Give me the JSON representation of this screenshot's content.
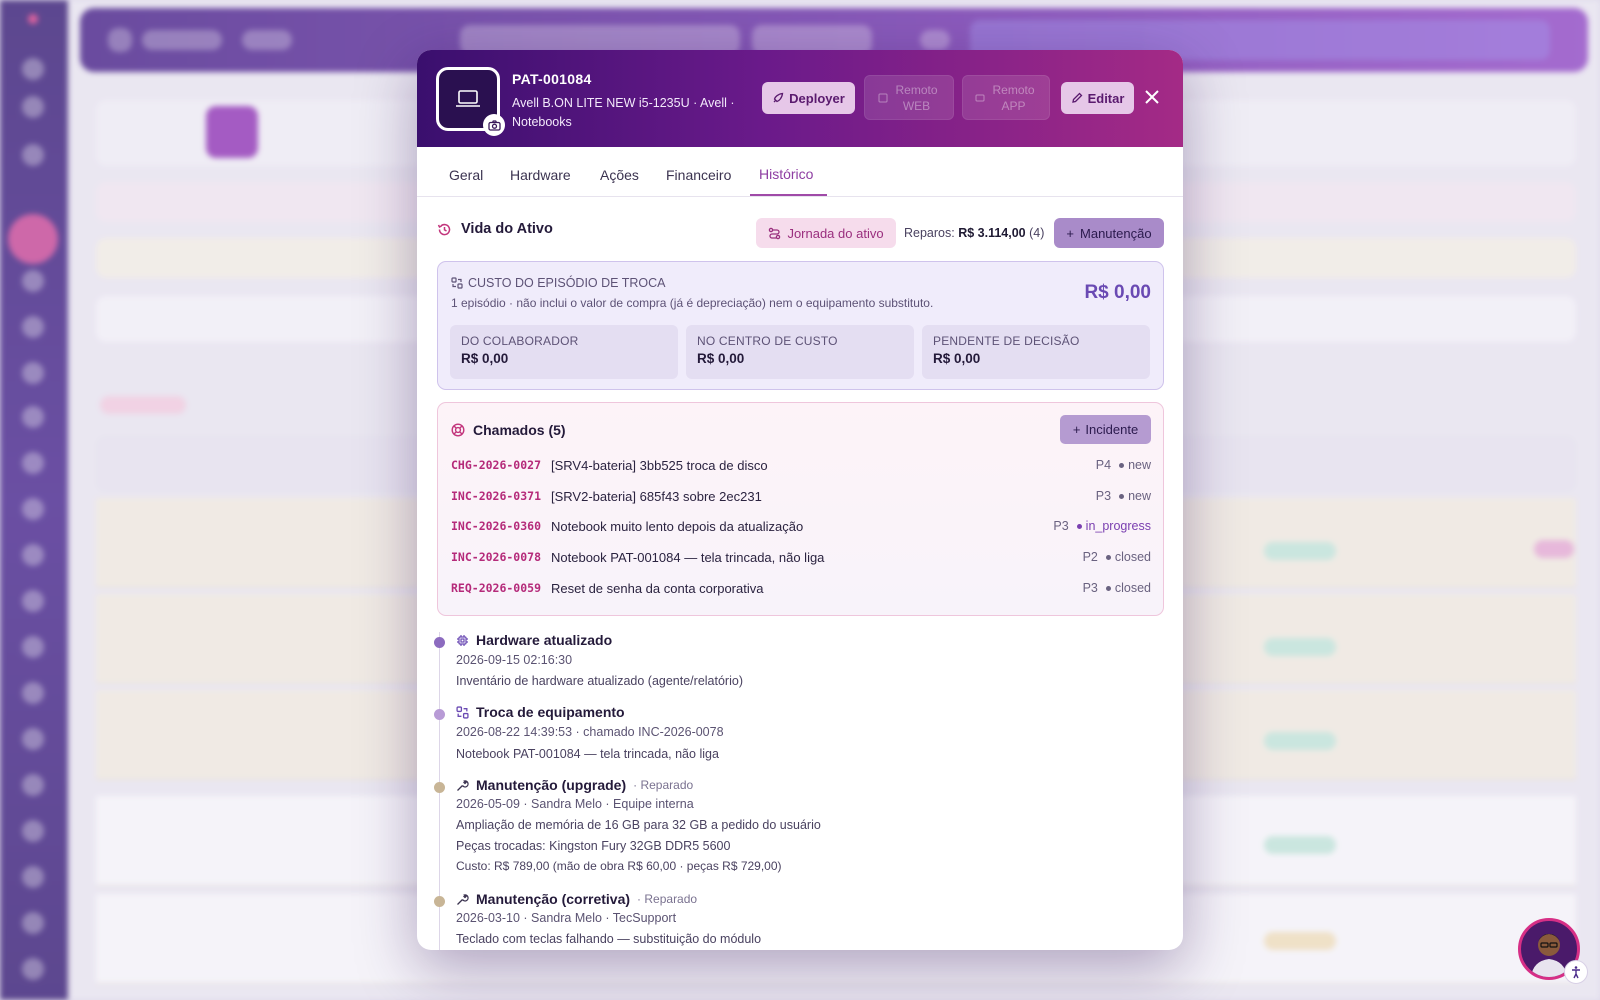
{
  "modal": {
    "asset_id": "PAT-001084",
    "asset_description": "Avell B.ON LITE NEW i5-1235U · Avell · Notebooks",
    "buttons": {
      "deploy": "Deployer",
      "remote_web": "Remoto WEB",
      "remote_app": "Remoto APP",
      "edit": "Editar"
    },
    "tabs": [
      "Geral",
      "Hardware",
      "Ações",
      "Financeiro",
      "Histórico"
    ],
    "active_tab": "Histórico",
    "history": {
      "title": "Vida do Ativo",
      "journey_button": "Jornada do ativo",
      "repairs_label": "Reparos:",
      "repairs_value": "R$ 3.114,00",
      "repairs_count": "(4)",
      "maintenance_button": "Manutenção"
    },
    "swap_cost": {
      "title": "CUSTO DO EPISÓDIO DE TROCA",
      "description": "1 episódio · não inclui o valor de compra (já é depreciação) nem o equipamento substituto.",
      "total": "R$ 0,00",
      "boxes": [
        {
          "label": "DO COLABORADOR",
          "value": "R$ 0,00"
        },
        {
          "label": "NO CENTRO DE CUSTO",
          "value": "R$ 0,00"
        },
        {
          "label": "PENDENTE DE DECISÃO",
          "value": "R$ 0,00"
        }
      ]
    },
    "tickets": {
      "title": "Chamados (5)",
      "incident_button": "Incidente",
      "items": [
        {
          "code": "CHG-2026-0027",
          "title": "[SRV4-bateria] 3bb525 troca de disco",
          "priority": "P4",
          "status": "new"
        },
        {
          "code": "INC-2026-0371",
          "title": "[SRV2-bateria] 685f43 sobre 2ec231",
          "priority": "P3",
          "status": "new"
        },
        {
          "code": "INC-2026-0360",
          "title": "Notebook muito lento depois da atualização",
          "priority": "P3",
          "status": "in_progress"
        },
        {
          "code": "INC-2026-0078",
          "title": "Notebook PAT-001084 — tela trincada, não liga",
          "priority": "P2",
          "status": "closed"
        },
        {
          "code": "REQ-2026-0059",
          "title": "Reset de senha da conta corporativa",
          "priority": "P3",
          "status": "closed"
        }
      ]
    },
    "timeline": [
      {
        "title": "Hardware atualizado",
        "tag": "",
        "lines": [
          "2026-09-15 02:16:30",
          "Inventário de hardware atualizado (agente/relatório)"
        ]
      },
      {
        "title": "Troca de equipamento",
        "tag": "",
        "lines": [
          "2026-08-22 14:39:53 · chamado INC-2026-0078",
          "Notebook PAT-001084 — tela trincada, não liga"
        ]
      },
      {
        "title": "Manutenção (upgrade)",
        "tag": "· Reparado",
        "lines": [
          "2026-05-09 · Sandra Melo · Equipe interna",
          "Ampliação de memória de 16 GB para 32 GB a pedido do usuário",
          "Peças trocadas: Kingston Fury 32GB DDR5 5600",
          "Custo: R$ 789,00 (mão de obra R$ 60,00 · peças R$ 729,00)"
        ]
      },
      {
        "title": "Manutenção (corretiva)",
        "tag": "· Reparado",
        "lines": [
          "2026-03-10 · Sandra Melo · TecSupport",
          "Teclado com teclas falhando — substituição do módulo"
        ]
      }
    ]
  },
  "colors": {
    "brand_purple": "#3a0f6e",
    "brand_magenta": "#a42a86",
    "accent_pink": "#b52a7a",
    "active_tab": "#8e3ea2",
    "cost_total": "#6a4ab3"
  },
  "icons": {
    "thumbnail": "laptop-icon",
    "camera": "camera-icon",
    "deploy": "rocket-icon",
    "remote_web": "remote-web-icon",
    "remote_app": "remote-app-icon",
    "edit": "pencil-icon",
    "close": "close-icon",
    "history": "history-icon",
    "journey": "route-icon",
    "maintenance": "plus-icon",
    "swap_cost": "swap-icon",
    "tickets": "lifebuoy-icon",
    "incident": "plus-icon",
    "timeline": [
      "chip-icon",
      "swap-icon",
      "wrench-icon",
      "wrench-icon"
    ],
    "accessibility": "accessibility-icon"
  }
}
